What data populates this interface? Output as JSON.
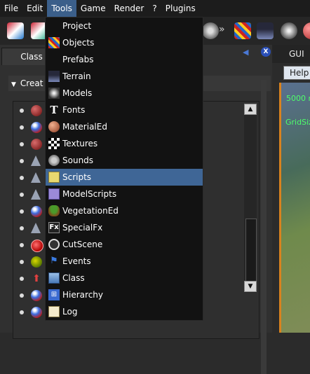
{
  "menubar": {
    "items": [
      "File",
      "Edit",
      "Tools",
      "Game",
      "Render",
      "?",
      "Plugins"
    ],
    "active": "Tools"
  },
  "left_panel": {
    "tab_label": "Class",
    "section_label": "Creat"
  },
  "right_panel": {
    "tab_label": "GUI",
    "help_label": "Help",
    "viewport_text1": "5000 r",
    "viewport_text2": "GridSiz",
    "x_button": "X"
  },
  "tools_menu": {
    "items": [
      {
        "label": "Project",
        "icon": ""
      },
      {
        "label": "Objects",
        "icon": "objects-icon"
      },
      {
        "label": "Prefabs",
        "icon": ""
      },
      {
        "label": "Terrain",
        "icon": "terrain-icon"
      },
      {
        "label": "Models",
        "icon": "models-icon"
      },
      {
        "label": "Fonts",
        "icon": "fonts-icon"
      },
      {
        "label": "MaterialEd",
        "icon": "material-icon"
      },
      {
        "label": "Textures",
        "icon": "textures-icon"
      },
      {
        "label": "Sounds",
        "icon": "sounds-icon"
      },
      {
        "label": "Scripts",
        "icon": "scripts-icon"
      },
      {
        "label": "ModelScripts",
        "icon": "modelscripts-icon"
      },
      {
        "label": "VegetationEd",
        "icon": "vegetation-icon"
      },
      {
        "label": "SpecialFx",
        "icon": "specialfx-icon"
      },
      {
        "label": "CutScene",
        "icon": "cutscene-icon"
      },
      {
        "label": "Events",
        "icon": "events-icon"
      },
      {
        "label": "Class",
        "icon": "class-icon"
      },
      {
        "label": "Hierarchy",
        "icon": "hierarchy-icon"
      },
      {
        "label": "Log",
        "icon": "log-icon"
      }
    ],
    "highlighted": "Scripts"
  },
  "colors": {
    "menu_highlight": "#3f6696",
    "viewport_text": "#4dff6a",
    "viewport_border": "#d9821e"
  }
}
